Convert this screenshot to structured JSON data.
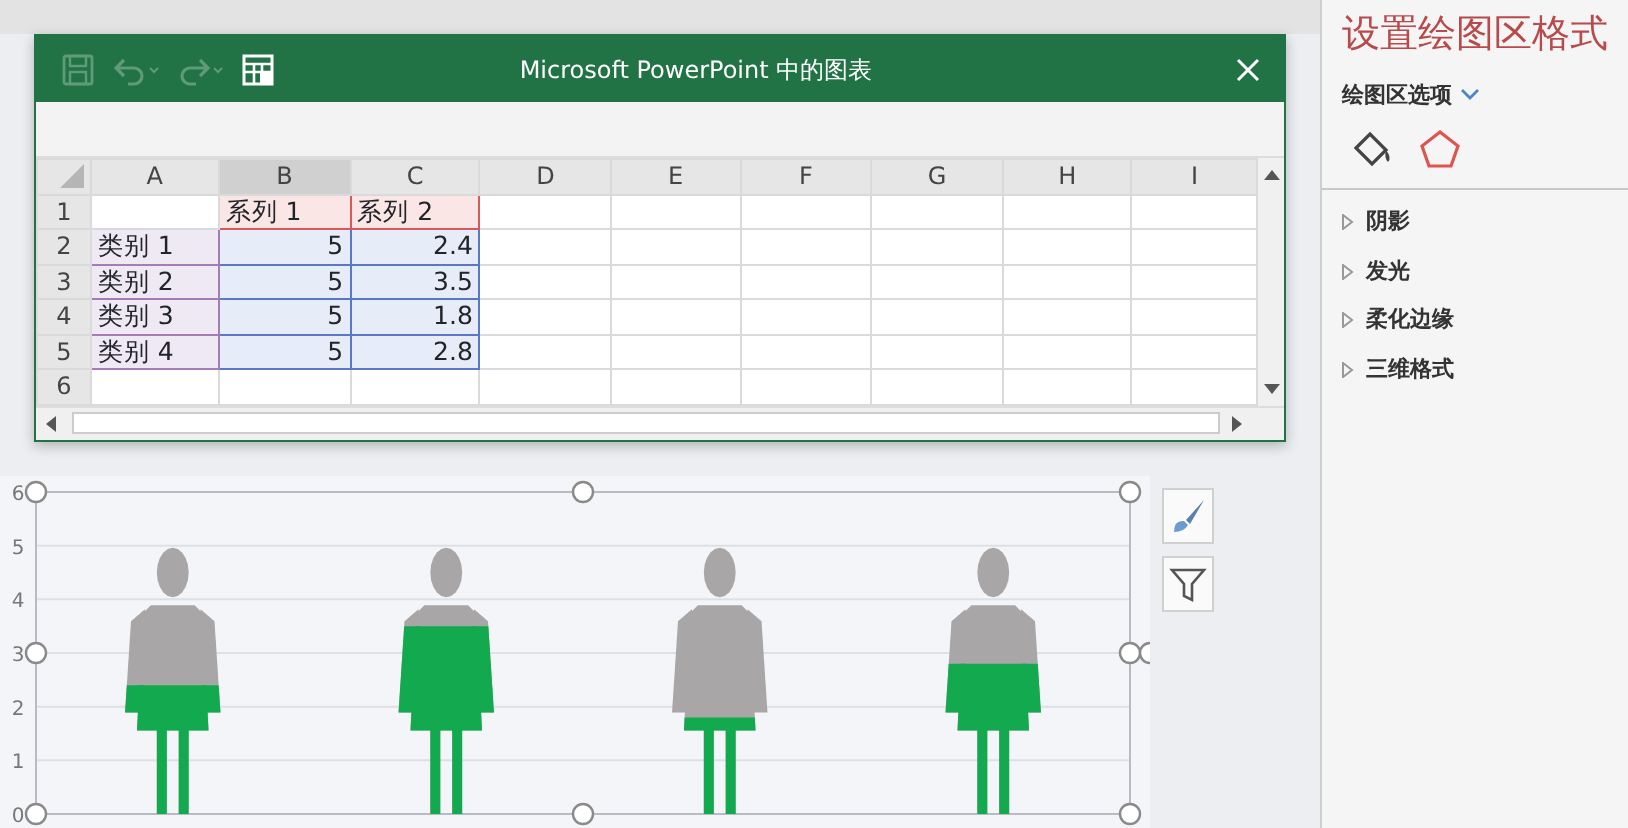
{
  "spreadsheet_window": {
    "title": "Microsoft PowerPoint 中的图表",
    "toolbar": [
      {
        "kind": "save",
        "disabled": true
      },
      {
        "kind": "undo",
        "disabled": true
      },
      {
        "kind": "redo",
        "disabled": true
      },
      {
        "kind": "edit_data",
        "disabled": false
      }
    ],
    "columns": [
      {
        "label": "A",
        "selected": false
      },
      {
        "label": "B",
        "selected": true
      },
      {
        "label": "C",
        "selected": false
      },
      {
        "label": "D",
        "selected": false
      },
      {
        "label": "E",
        "selected": false
      },
      {
        "label": "F",
        "selected": false
      },
      {
        "label": "G",
        "selected": false
      },
      {
        "label": "H",
        "selected": false
      },
      {
        "label": "I",
        "selected": false
      }
    ],
    "rows": [
      {
        "number": "1",
        "cells": [
          {
            "kind": "blank"
          },
          {
            "kind": "series",
            "text": "系列 1"
          },
          {
            "kind": "series",
            "text": "系列 2"
          }
        ]
      },
      {
        "number": "2",
        "cells": [
          {
            "kind": "category",
            "text": "类别 1"
          },
          {
            "kind": "value",
            "text": "5"
          },
          {
            "kind": "value",
            "text": "2.4"
          }
        ]
      },
      {
        "number": "3",
        "cells": [
          {
            "kind": "category",
            "text": "类别 2"
          },
          {
            "kind": "value",
            "text": "5"
          },
          {
            "kind": "value",
            "text": "3.5"
          }
        ]
      },
      {
        "number": "4",
        "cells": [
          {
            "kind": "category",
            "text": "类别 3"
          },
          {
            "kind": "value",
            "text": "5"
          },
          {
            "kind": "value",
            "text": "1.8"
          }
        ]
      },
      {
        "number": "5",
        "cells": [
          {
            "kind": "category",
            "text": "类别 4"
          },
          {
            "kind": "value",
            "text": "5"
          },
          {
            "kind": "value",
            "text": "2.8"
          }
        ]
      },
      {
        "number": "6"
      }
    ]
  },
  "chart": {
    "axis_labels": [
      "6",
      "5",
      "4",
      "3",
      "2",
      "1",
      "0"
    ],
    "series": [
      {
        "color": "#a8a6a7"
      },
      {
        "color": "#12a94f"
      }
    ]
  },
  "chart_tools": [
    {
      "kind": "style"
    },
    {
      "kind": "filter"
    }
  ],
  "format_pane": {
    "title": "设置绘图区格式",
    "section": "绘图区选项",
    "tabs": [
      {
        "kind": "fill",
        "selected": false
      },
      {
        "kind": "effects",
        "selected": true
      }
    ],
    "items": [
      {
        "label": "阴影",
        "expanded": false
      },
      {
        "label": "发光",
        "expanded": false
      },
      {
        "label": "柔化边缘",
        "expanded": false
      },
      {
        "label": "三维格式",
        "expanded": false
      }
    ]
  }
}
